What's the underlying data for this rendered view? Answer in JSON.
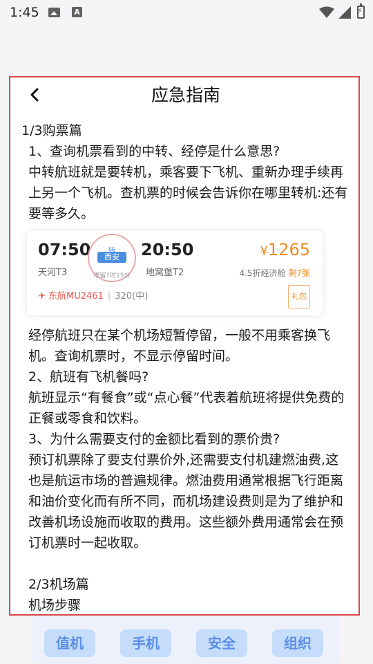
{
  "status_bar": {
    "time": "1:45",
    "a_icon": "A"
  },
  "dialog": {
    "title": "应急指南",
    "section1": "1/3购票篇",
    "q1": "1、查询机票看到的中转、经停是什么意思?",
    "a1": "中转航班就是要转机，乘客要下飞机、重新办理手续再上另一个飞机。查机票的时候会告诉你在哪里转机:还有要等多久。",
    "a1b": "经停航班只在某个机场短暂停留，一般不用乘客换飞机。查询机票时，不显示停留时间。",
    "q2": "2、航班有飞机餐吗?",
    "a2": "航班显示“有餐食”或“点心餐”代表着航班将提供免费的正餐或零食和饮料。",
    "q3": "3、为什么需要支付的金额比看到的票价贵?",
    "a3": "预订机票除了要支付票价外,还需要支付机建燃油费,这也是航运市场的普遍规律。燃油费用通常根据飞行距离和油价变化而有所不同，而机场建设费则是为了维护和改善机场设施而收取的费用。这些额外费用通常会在预订机票时一起收取。",
    "section2": "2/3机场篇",
    "s2_line": "机场步骤"
  },
  "ticket": {
    "dep_time": "07:50",
    "dep_terminal": "天河T3",
    "stamp_top": "转",
    "stamp_city": "西安",
    "stamp_stay": "停留7时15分",
    "arr_time": "20:50",
    "arr_terminal": "地窝堡T2",
    "price_currency": "¥",
    "price": "1265",
    "discount": "4.5折经济舱",
    "seats_left": "剩7张",
    "airline": "东航MU2461",
    "aircraft": "320(中)",
    "badge": "礼包"
  },
  "bottom_nav": [
    "值机",
    "手机",
    "安全",
    "组织"
  ],
  "colors": {
    "accent_red": "#d94848",
    "price_orange": "#f0891f",
    "blue": "#4a8ee0"
  }
}
